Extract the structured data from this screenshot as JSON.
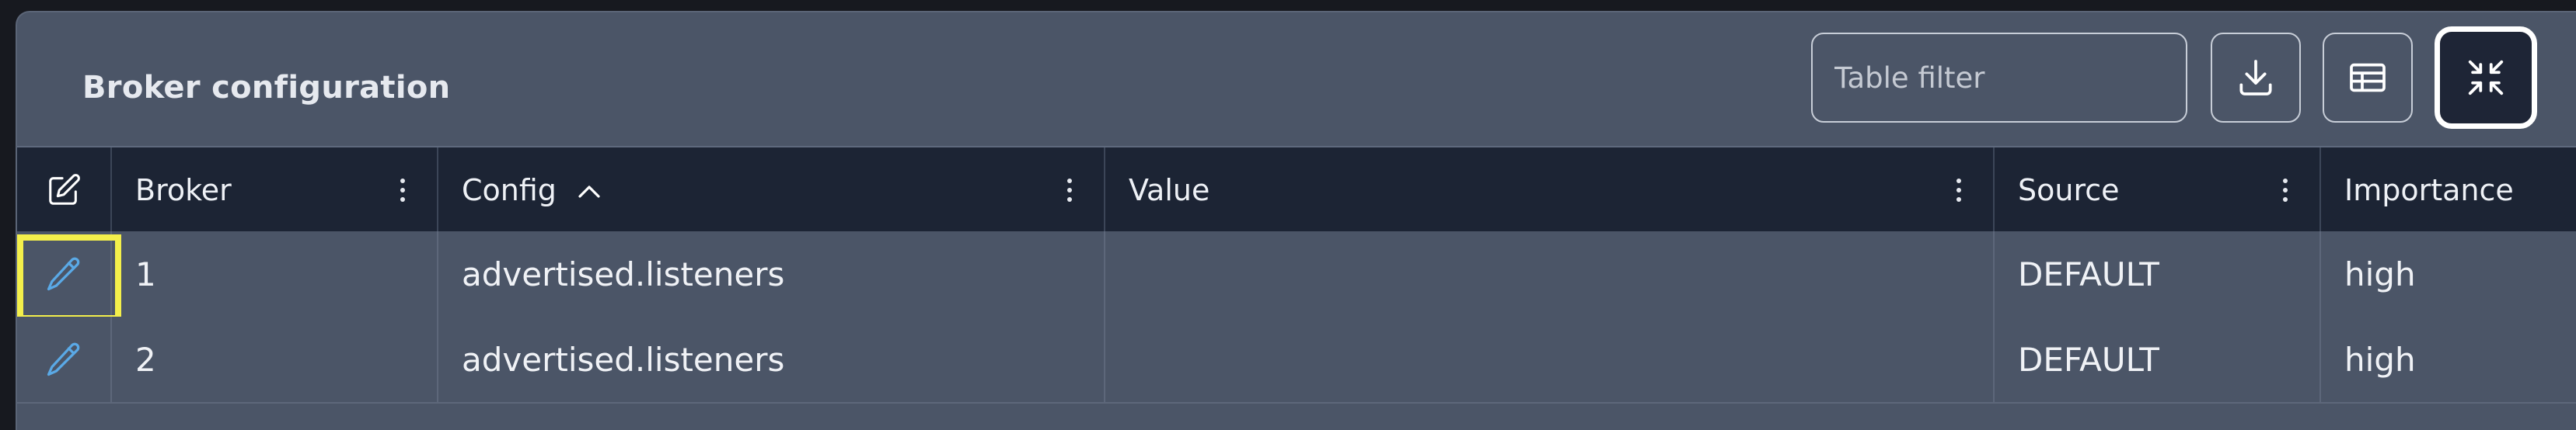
{
  "panel": {
    "title": "Broker configuration"
  },
  "toolbar": {
    "filter_placeholder": "Table filter",
    "download_icon": "download-icon",
    "columns_icon": "table-columns-icon",
    "collapse_icon": "collapse-arrows-icon"
  },
  "table": {
    "columns": [
      {
        "label": "Broker",
        "has_menu": true
      },
      {
        "label": "Config",
        "has_menu": true,
        "sort": "ascending"
      },
      {
        "label": "Value",
        "has_menu": true
      },
      {
        "label": "Source",
        "has_menu": true
      },
      {
        "label": "Importance",
        "has_menu": false
      }
    ],
    "rows": [
      {
        "broker": "1",
        "config": "advertised.listeners",
        "value": "",
        "source": "DEFAULT",
        "importance": "high"
      },
      {
        "broker": "2",
        "config": "advertised.listeners",
        "value": "",
        "source": "DEFAULT",
        "importance": "high"
      }
    ]
  },
  "colors": {
    "panel_bg": "#4b5567",
    "header_bg": "#1c2434",
    "edit_icon": "#5aa9e6",
    "highlight": "#f3ef4b"
  }
}
